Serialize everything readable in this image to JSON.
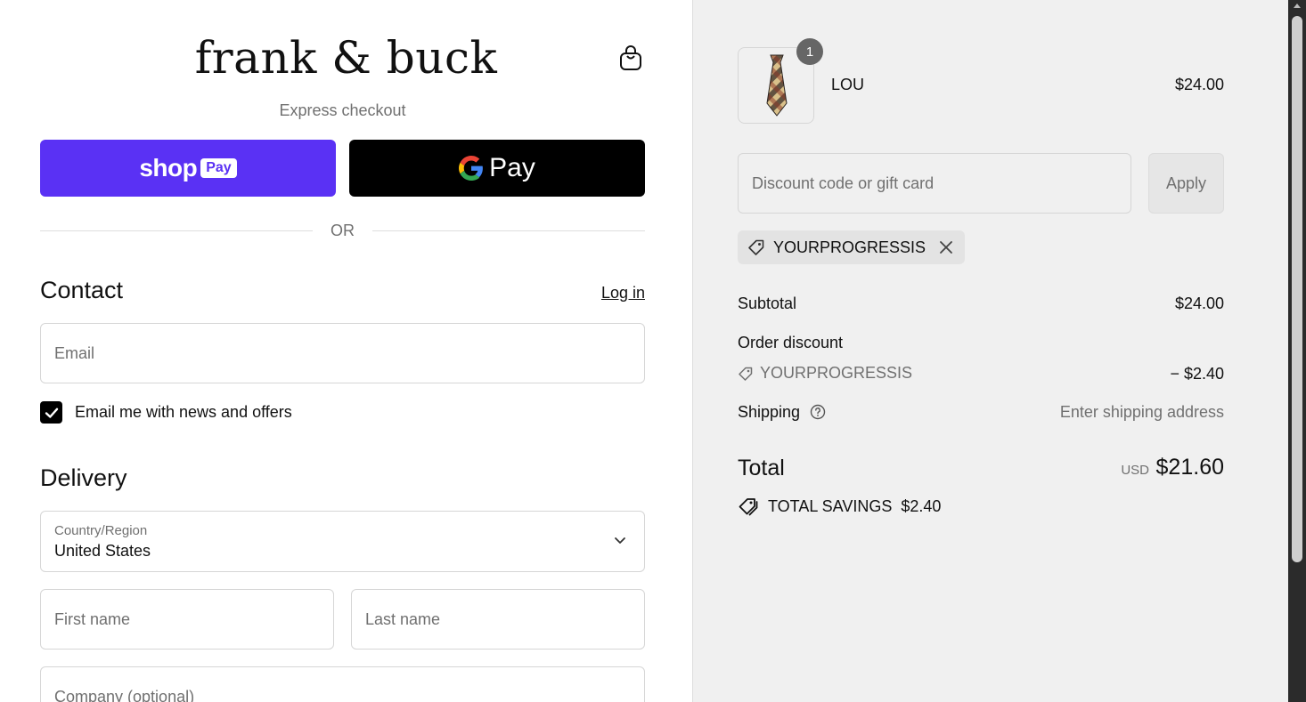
{
  "brand": {
    "logo_text": "frank & buck"
  },
  "express": {
    "label": "Express checkout",
    "shop_pay_word": "shop",
    "shop_pay_box": "Pay",
    "gpay_word": "Pay"
  },
  "divider": {
    "or_text": "OR"
  },
  "contact": {
    "title": "Contact",
    "login_label": "Log in",
    "email_placeholder": "Email",
    "newsletter_label": "Email me with news and offers",
    "newsletter_checked": true
  },
  "delivery": {
    "title": "Delivery",
    "country_label": "Country/Region",
    "country_value": "United States",
    "first_name_placeholder": "First name",
    "last_name_placeholder": "Last name",
    "company_placeholder": "Company (optional)"
  },
  "summary": {
    "item": {
      "name": "LOU",
      "price": "$24.00",
      "quantity": "1"
    },
    "discount_placeholder": "Discount code or gift card",
    "apply_label": "Apply",
    "applied_code": "YOURPROGRESSIS",
    "subtotal_label": "Subtotal",
    "subtotal_value": "$24.00",
    "order_discount_label": "Order discount",
    "order_discount_code": "YOURPROGRESSIS",
    "order_discount_value": "− $2.40",
    "shipping_label": "Shipping",
    "shipping_value": "Enter shipping address",
    "total_label": "Total",
    "total_currency": "USD",
    "total_value": "$21.60",
    "savings_label": "TOTAL SAVINGS",
    "savings_value": "$2.40"
  },
  "colors": {
    "shop_pay": "#5a31f4",
    "gpay": "#000000",
    "summary_bg": "#f0f0f0"
  }
}
